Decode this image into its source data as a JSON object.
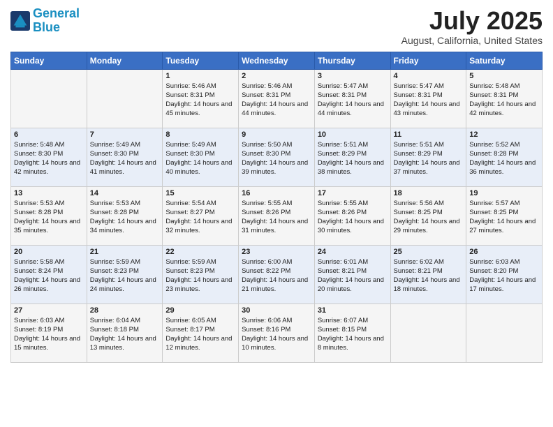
{
  "header": {
    "logo_line1": "General",
    "logo_line2": "Blue",
    "month": "July 2025",
    "location": "August, California, United States"
  },
  "weekdays": [
    "Sunday",
    "Monday",
    "Tuesday",
    "Wednesday",
    "Thursday",
    "Friday",
    "Saturday"
  ],
  "weeks": [
    [
      {
        "day": "",
        "text": ""
      },
      {
        "day": "",
        "text": ""
      },
      {
        "day": "1",
        "text": "Sunrise: 5:46 AM\nSunset: 8:31 PM\nDaylight: 14 hours and 45 minutes."
      },
      {
        "day": "2",
        "text": "Sunrise: 5:46 AM\nSunset: 8:31 PM\nDaylight: 14 hours and 44 minutes."
      },
      {
        "day": "3",
        "text": "Sunrise: 5:47 AM\nSunset: 8:31 PM\nDaylight: 14 hours and 44 minutes."
      },
      {
        "day": "4",
        "text": "Sunrise: 5:47 AM\nSunset: 8:31 PM\nDaylight: 14 hours and 43 minutes."
      },
      {
        "day": "5",
        "text": "Sunrise: 5:48 AM\nSunset: 8:31 PM\nDaylight: 14 hours and 42 minutes."
      }
    ],
    [
      {
        "day": "6",
        "text": "Sunrise: 5:48 AM\nSunset: 8:30 PM\nDaylight: 14 hours and 42 minutes."
      },
      {
        "day": "7",
        "text": "Sunrise: 5:49 AM\nSunset: 8:30 PM\nDaylight: 14 hours and 41 minutes."
      },
      {
        "day": "8",
        "text": "Sunrise: 5:49 AM\nSunset: 8:30 PM\nDaylight: 14 hours and 40 minutes."
      },
      {
        "day": "9",
        "text": "Sunrise: 5:50 AM\nSunset: 8:30 PM\nDaylight: 14 hours and 39 minutes."
      },
      {
        "day": "10",
        "text": "Sunrise: 5:51 AM\nSunset: 8:29 PM\nDaylight: 14 hours and 38 minutes."
      },
      {
        "day": "11",
        "text": "Sunrise: 5:51 AM\nSunset: 8:29 PM\nDaylight: 14 hours and 37 minutes."
      },
      {
        "day": "12",
        "text": "Sunrise: 5:52 AM\nSunset: 8:28 PM\nDaylight: 14 hours and 36 minutes."
      }
    ],
    [
      {
        "day": "13",
        "text": "Sunrise: 5:53 AM\nSunset: 8:28 PM\nDaylight: 14 hours and 35 minutes."
      },
      {
        "day": "14",
        "text": "Sunrise: 5:53 AM\nSunset: 8:28 PM\nDaylight: 14 hours and 34 minutes."
      },
      {
        "day": "15",
        "text": "Sunrise: 5:54 AM\nSunset: 8:27 PM\nDaylight: 14 hours and 32 minutes."
      },
      {
        "day": "16",
        "text": "Sunrise: 5:55 AM\nSunset: 8:26 PM\nDaylight: 14 hours and 31 minutes."
      },
      {
        "day": "17",
        "text": "Sunrise: 5:55 AM\nSunset: 8:26 PM\nDaylight: 14 hours and 30 minutes."
      },
      {
        "day": "18",
        "text": "Sunrise: 5:56 AM\nSunset: 8:25 PM\nDaylight: 14 hours and 29 minutes."
      },
      {
        "day": "19",
        "text": "Sunrise: 5:57 AM\nSunset: 8:25 PM\nDaylight: 14 hours and 27 minutes."
      }
    ],
    [
      {
        "day": "20",
        "text": "Sunrise: 5:58 AM\nSunset: 8:24 PM\nDaylight: 14 hours and 26 minutes."
      },
      {
        "day": "21",
        "text": "Sunrise: 5:59 AM\nSunset: 8:23 PM\nDaylight: 14 hours and 24 minutes."
      },
      {
        "day": "22",
        "text": "Sunrise: 5:59 AM\nSunset: 8:23 PM\nDaylight: 14 hours and 23 minutes."
      },
      {
        "day": "23",
        "text": "Sunrise: 6:00 AM\nSunset: 8:22 PM\nDaylight: 14 hours and 21 minutes."
      },
      {
        "day": "24",
        "text": "Sunrise: 6:01 AM\nSunset: 8:21 PM\nDaylight: 14 hours and 20 minutes."
      },
      {
        "day": "25",
        "text": "Sunrise: 6:02 AM\nSunset: 8:21 PM\nDaylight: 14 hours and 18 minutes."
      },
      {
        "day": "26",
        "text": "Sunrise: 6:03 AM\nSunset: 8:20 PM\nDaylight: 14 hours and 17 minutes."
      }
    ],
    [
      {
        "day": "27",
        "text": "Sunrise: 6:03 AM\nSunset: 8:19 PM\nDaylight: 14 hours and 15 minutes."
      },
      {
        "day": "28",
        "text": "Sunrise: 6:04 AM\nSunset: 8:18 PM\nDaylight: 14 hours and 13 minutes."
      },
      {
        "day": "29",
        "text": "Sunrise: 6:05 AM\nSunset: 8:17 PM\nDaylight: 14 hours and 12 minutes."
      },
      {
        "day": "30",
        "text": "Sunrise: 6:06 AM\nSunset: 8:16 PM\nDaylight: 14 hours and 10 minutes."
      },
      {
        "day": "31",
        "text": "Sunrise: 6:07 AM\nSunset: 8:15 PM\nDaylight: 14 hours and 8 minutes."
      },
      {
        "day": "",
        "text": ""
      },
      {
        "day": "",
        "text": ""
      }
    ]
  ]
}
